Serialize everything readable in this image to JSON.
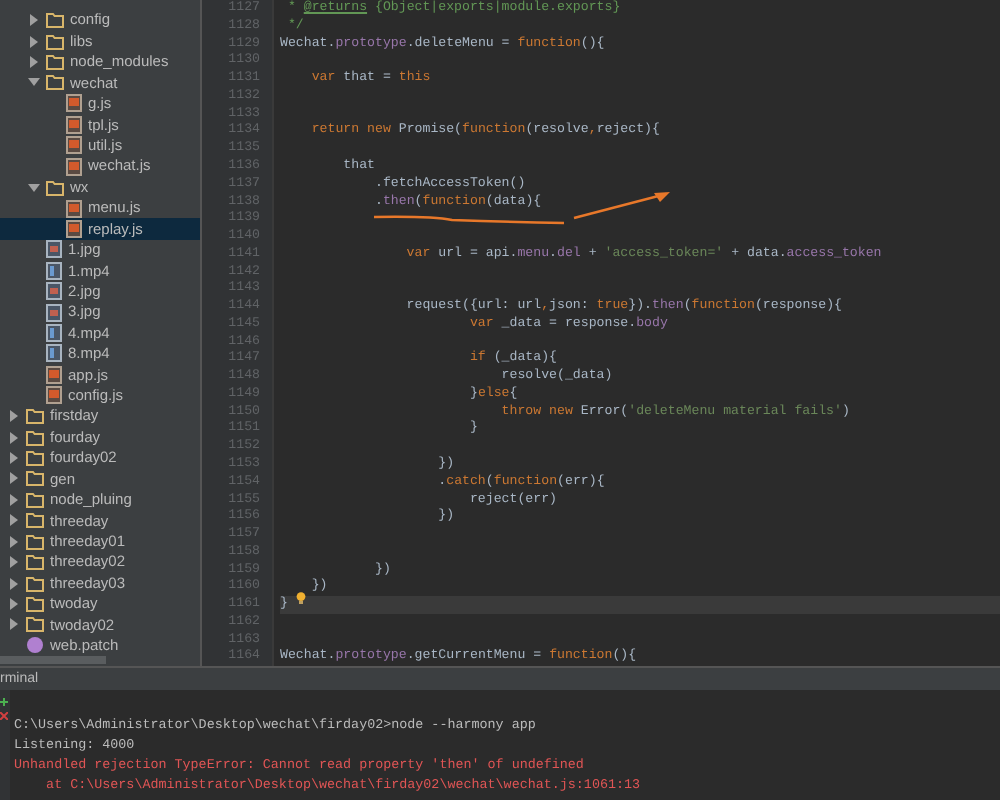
{
  "project_tree": [
    {
      "name": "config",
      "kind": "folder",
      "expanded": false,
      "selected": false
    },
    {
      "name": "libs",
      "kind": "folder",
      "expanded": false,
      "selected": false
    },
    {
      "name": "node_modules",
      "kind": "folder",
      "expanded": false,
      "selected": false
    },
    {
      "name": "wechat",
      "kind": "folder",
      "expanded": true,
      "selected": false,
      "children": [
        {
          "name": "g.js",
          "kind": "js",
          "selected": false
        },
        {
          "name": "tpl.js",
          "kind": "js",
          "selected": false
        },
        {
          "name": "util.js",
          "kind": "js",
          "selected": false
        },
        {
          "name": "wechat.js",
          "kind": "js",
          "selected": false
        }
      ]
    },
    {
      "name": "wx",
      "kind": "folder",
      "expanded": true,
      "selected": false,
      "children": [
        {
          "name": "menu.js",
          "kind": "js",
          "selected": false
        },
        {
          "name": "replay.js",
          "kind": "js",
          "selected": true
        }
      ]
    },
    {
      "name": "1.jpg",
      "kind": "image",
      "selected": false
    },
    {
      "name": "1.mp4",
      "kind": "video",
      "selected": false
    },
    {
      "name": "2.jpg",
      "kind": "image",
      "selected": false
    },
    {
      "name": "3.jpg",
      "kind": "image",
      "selected": false
    },
    {
      "name": "4.mp4",
      "kind": "video",
      "selected": false
    },
    {
      "name": "8.mp4",
      "kind": "video",
      "selected": false
    },
    {
      "name": "app.js",
      "kind": "js",
      "selected": false
    },
    {
      "name": "config.js",
      "kind": "js",
      "selected": false
    }
  ],
  "project_tree_root": [
    {
      "name": "firstday",
      "kind": "folder",
      "expanded": false,
      "selected": false
    },
    {
      "name": "fourday",
      "kind": "folder",
      "expanded": false,
      "selected": false
    },
    {
      "name": "fourday02",
      "kind": "folder",
      "expanded": false,
      "selected": false
    },
    {
      "name": "gen",
      "kind": "folder",
      "expanded": false,
      "selected": false
    },
    {
      "name": "node_pluing",
      "kind": "folder",
      "expanded": false,
      "selected": false
    },
    {
      "name": "threeday",
      "kind": "folder",
      "expanded": false,
      "selected": false
    },
    {
      "name": "threeday01",
      "kind": "folder",
      "expanded": false,
      "selected": false
    },
    {
      "name": "threeday02",
      "kind": "folder",
      "expanded": false,
      "selected": false
    },
    {
      "name": "threeday03",
      "kind": "folder",
      "expanded": false,
      "selected": false
    },
    {
      "name": "twoday",
      "kind": "folder",
      "expanded": false,
      "selected": false
    },
    {
      "name": "twoday02",
      "kind": "folder",
      "expanded": false,
      "selected": false
    },
    {
      "name": "web.patch",
      "kind": "patch",
      "selected": false
    }
  ],
  "editor": {
    "lines": [
      {
        "number": "1127",
        "current": false,
        "tokens": [
          {
            "text": " * ",
            "kind": "comment"
          },
          {
            "text": "@returns",
            "kind": "doctag"
          },
          {
            "text": " {Object|exports|module.exports}",
            "kind": "comment"
          }
        ]
      },
      {
        "number": "1128",
        "current": false,
        "tokens": [
          {
            "text": " */",
            "kind": "comment"
          }
        ]
      },
      {
        "number": "1129",
        "current": false,
        "tokens": [
          {
            "text": "Wechat.",
            "kind": "plain"
          },
          {
            "text": "prototype",
            "kind": "property"
          },
          {
            "text": ".deleteMenu = ",
            "kind": "plain"
          },
          {
            "text": "function",
            "kind": "keyword"
          },
          {
            "text": "(){",
            "kind": "plain"
          }
        ]
      },
      {
        "number": "1130",
        "current": false
      },
      {
        "number": "1131",
        "current": false,
        "tokens": [
          {
            "text": "    var",
            "kind": "keyword"
          },
          {
            "text": " that = ",
            "kind": "plain"
          },
          {
            "text": "this",
            "kind": "keyword"
          }
        ]
      },
      {
        "number": "1132",
        "current": false
      },
      {
        "number": "1133",
        "current": false
      },
      {
        "number": "1134",
        "current": false,
        "tokens": [
          {
            "text": "    return new",
            "kind": "keyword"
          },
          {
            "text": " Promise(",
            "kind": "plain"
          },
          {
            "text": "function",
            "kind": "keyword"
          },
          {
            "text": "(resolve",
            "kind": "plain"
          },
          {
            "text": ",",
            "kind": "keyword"
          },
          {
            "text": "reject){",
            "kind": "plain"
          }
        ]
      },
      {
        "number": "1135",
        "current": false
      },
      {
        "number": "1136",
        "current": false,
        "tokens": [
          {
            "text": "        that",
            "kind": "plain"
          }
        ]
      },
      {
        "number": "1137",
        "current": false,
        "tokens": [
          {
            "text": "            .fetchAccessToken()",
            "kind": "plain"
          }
        ]
      },
      {
        "number": "1138",
        "current": false,
        "tokens": [
          {
            "text": "            .",
            "kind": "plain"
          },
          {
            "text": "then",
            "kind": "property"
          },
          {
            "text": "(",
            "kind": "plain"
          },
          {
            "text": "function",
            "kind": "keyword"
          },
          {
            "text": "(data){",
            "kind": "plain"
          }
        ]
      },
      {
        "number": "1139",
        "current": false
      },
      {
        "number": "1140",
        "current": false
      },
      {
        "number": "1141",
        "current": false,
        "tokens": [
          {
            "text": "                var",
            "kind": "keyword"
          },
          {
            "text": " url = api.",
            "kind": "plain"
          },
          {
            "text": "menu",
            "kind": "property"
          },
          {
            "text": ".",
            "kind": "plain"
          },
          {
            "text": "del",
            "kind": "property"
          },
          {
            "text": " + ",
            "kind": "plain"
          },
          {
            "text": "'access_token='",
            "kind": "string"
          },
          {
            "text": " + data.",
            "kind": "plain"
          },
          {
            "text": "access_token",
            "kind": "property"
          }
        ]
      },
      {
        "number": "1142",
        "current": false
      },
      {
        "number": "1143",
        "current": false
      },
      {
        "number": "1144",
        "current": false,
        "tokens": [
          {
            "text": "                request({url: url",
            "kind": "plain"
          },
          {
            "text": ",",
            "kind": "keyword"
          },
          {
            "text": "json: ",
            "kind": "plain"
          },
          {
            "text": "true",
            "kind": "keyword"
          },
          {
            "text": "}).",
            "kind": "plain"
          },
          {
            "text": "then",
            "kind": "property"
          },
          {
            "text": "(",
            "kind": "plain"
          },
          {
            "text": "function",
            "kind": "keyword"
          },
          {
            "text": "(response){",
            "kind": "plain"
          }
        ]
      },
      {
        "number": "1145",
        "current": false,
        "tokens": [
          {
            "text": "                        var",
            "kind": "keyword"
          },
          {
            "text": " _data = response.",
            "kind": "plain"
          },
          {
            "text": "body",
            "kind": "property"
          }
        ]
      },
      {
        "number": "1146",
        "current": false
      },
      {
        "number": "1147",
        "current": false,
        "tokens": [
          {
            "text": "                        if",
            "kind": "keyword"
          },
          {
            "text": " (_data){",
            "kind": "plain"
          }
        ]
      },
      {
        "number": "1148",
        "current": false,
        "tokens": [
          {
            "text": "                            resolve(_data)",
            "kind": "plain"
          }
        ]
      },
      {
        "number": "1149",
        "current": false,
        "tokens": [
          {
            "text": "                        }",
            "kind": "plain"
          },
          {
            "text": "else",
            "kind": "keyword"
          },
          {
            "text": "{",
            "kind": "plain"
          }
        ]
      },
      {
        "number": "1150",
        "current": false,
        "tokens": [
          {
            "text": "                            throw new",
            "kind": "keyword"
          },
          {
            "text": " Error(",
            "kind": "plain"
          },
          {
            "text": "'deleteMenu material fails'",
            "kind": "string"
          },
          {
            "text": ")",
            "kind": "plain"
          }
        ]
      },
      {
        "number": "1151",
        "current": false,
        "tokens": [
          {
            "text": "                        }",
            "kind": "plain"
          }
        ]
      },
      {
        "number": "1152",
        "current": false
      },
      {
        "number": "1153",
        "current": false,
        "tokens": [
          {
            "text": "                    })",
            "kind": "plain"
          }
        ]
      },
      {
        "number": "1154",
        "current": false,
        "tokens": [
          {
            "text": "                    .",
            "kind": "plain"
          },
          {
            "text": "catch",
            "kind": "keyword"
          },
          {
            "text": "(",
            "kind": "plain"
          },
          {
            "text": "function",
            "kind": "keyword"
          },
          {
            "text": "(err){",
            "kind": "plain"
          }
        ]
      },
      {
        "number": "1155",
        "current": false,
        "tokens": [
          {
            "text": "                        reject(err)",
            "kind": "plain"
          }
        ]
      },
      {
        "number": "1156",
        "current": false,
        "tokens": [
          {
            "text": "                    })",
            "kind": "plain"
          }
        ]
      },
      {
        "number": "1157",
        "current": false
      },
      {
        "number": "1158",
        "current": false
      },
      {
        "number": "1159",
        "current": false,
        "tokens": [
          {
            "text": "            })",
            "kind": "plain"
          }
        ]
      },
      {
        "number": "1160",
        "current": false,
        "tokens": [
          {
            "text": "    })",
            "kind": "plain"
          }
        ]
      },
      {
        "number": "1161",
        "current": true,
        "tokens": [
          {
            "text": "}",
            "kind": "plain"
          }
        ]
      },
      {
        "number": "1162",
        "current": false
      },
      {
        "number": "1163",
        "current": false
      },
      {
        "number": "1164",
        "current": false,
        "tokens": [
          {
            "text": "Wechat.",
            "kind": "plain"
          },
          {
            "text": "prototype",
            "kind": "property"
          },
          {
            "text": ".getCurrentMenu = ",
            "kind": "plain"
          },
          {
            "text": "function",
            "kind": "keyword"
          },
          {
            "text": "(){",
            "kind": "plain"
          }
        ]
      }
    ]
  },
  "terminal": {
    "title": "rminal",
    "lines": [
      {
        "text": "C:\\Users\\Administrator\\Desktop\\wechat\\firday02>node --harmony app",
        "kind": "normal"
      },
      {
        "text": "Listening: 4000",
        "kind": "normal"
      },
      {
        "text": "Unhandled rejection TypeError: Cannot read property 'then' of undefined",
        "kind": "error"
      },
      {
        "text": "    at C:\\Users\\Administrator\\Desktop\\wechat\\firday02\\wechat\\wechat.js:1061:13",
        "kind": "error"
      }
    ]
  }
}
